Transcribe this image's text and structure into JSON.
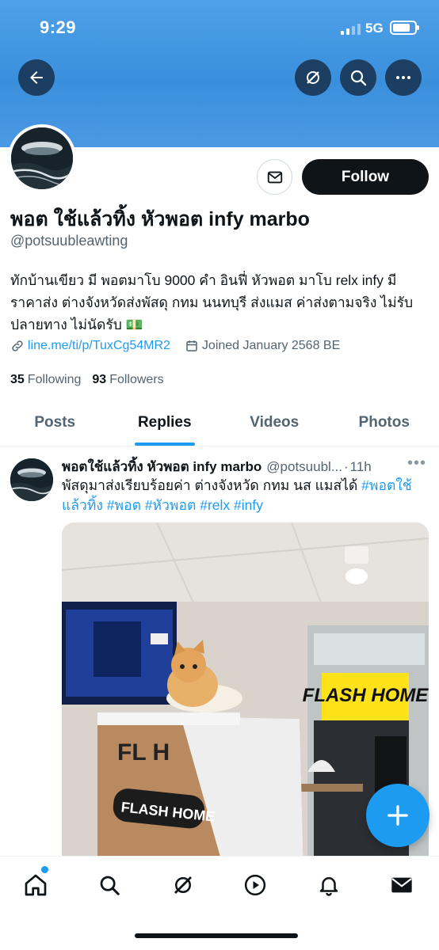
{
  "status_bar": {
    "time": "9:29",
    "network": "5G"
  },
  "profile": {
    "display_name": "พอต ใช้แล้วทิ้ง หัวพอต infy marbo",
    "handle": "@potsuubleawting",
    "bio": "ทักบ้านเขียว มี พอตมาโบ 9000 คำ อินฟี่ หัวพอต มาโบ relx infy มีราคาส่ง ต่างจังหวัดส่งพัสดุ กทม นนทบุรี ส่งแมส ค่าส่งตามจริง ไม่รับปลายทาง ไม่นัดรับ 💵",
    "link": "line.me/ti/p/TuxCg54MR2",
    "joined": "Joined January 2568 BE",
    "following_count": "35",
    "following_label": "Following",
    "followers_count": "93",
    "followers_label": "Followers",
    "follow_label": "Follow"
  },
  "tabs": [
    {
      "label": "Posts"
    },
    {
      "label": "Replies"
    },
    {
      "label": "Videos"
    },
    {
      "label": "Photos"
    }
  ],
  "active_tab": "Replies",
  "tweet": {
    "name": "พอตใช้แล้วทิ้ง หัวพอต infy marbo",
    "handle": "@potsuubl...",
    "time": "11h",
    "text": "พัสดุมาส่งเรียบร้อยค่า ต่างจังหวัด กทม นส แมสได้",
    "hashtags": [
      "#พอตใช้แล้วทิ้ง",
      "#พอต",
      "#หัวพอต",
      "#relx",
      "#infy"
    ],
    "photo": {
      "sign_text": "FLASH HOME",
      "counter_text": "FLASH HOME",
      "counter_logo": "FL  H"
    }
  },
  "icons": {
    "back": "arrow-left-icon",
    "grok": "grok-icon",
    "search": "search-icon",
    "more": "more-horizontal-icon",
    "message": "mail-icon",
    "link": "link-icon",
    "calendar": "calendar-icon",
    "compose": "plus-icon",
    "nav": [
      "home-icon",
      "search-icon",
      "grok-icon",
      "play-icon",
      "bell-icon",
      "mail-icon"
    ]
  },
  "colors": {
    "accent": "#1d9bf0",
    "banner": "#4a9be4",
    "text": "#0f1419",
    "muted": "#536471"
  }
}
